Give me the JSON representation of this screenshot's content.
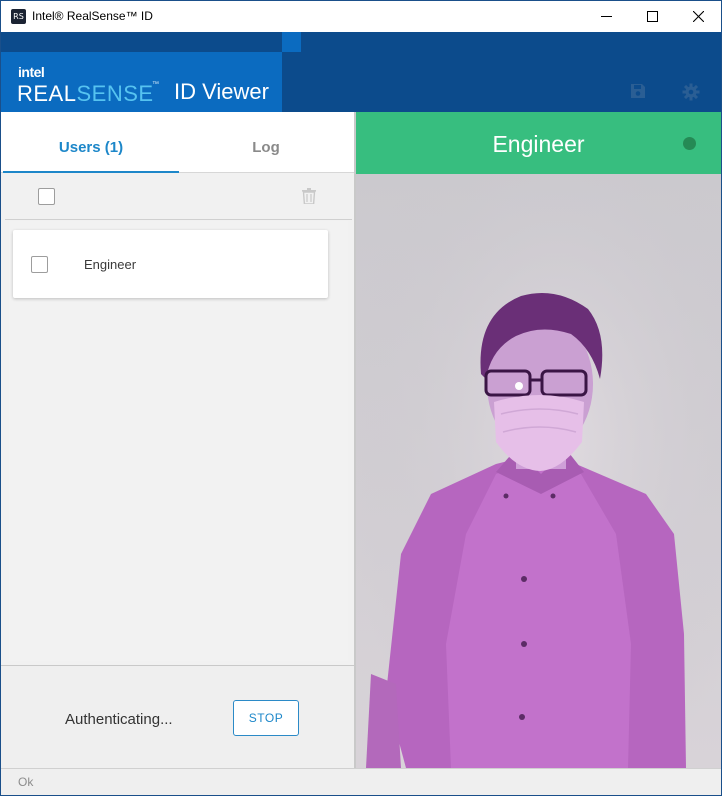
{
  "window": {
    "title": "Intel® RealSense™ ID",
    "app_icon_text": "RS"
  },
  "header": {
    "brand_intel": "intel",
    "brand_real": "REAL",
    "brand_sense": "SENSE",
    "brand_tm": "™",
    "app_title": "ID Viewer",
    "icons": [
      "save-icon",
      "gear-icon"
    ]
  },
  "tabs": {
    "users_label": "Users (1)",
    "log_label": "Log",
    "active": "Users (1)"
  },
  "users": {
    "items": [
      {
        "name": "Engineer",
        "checked": false
      }
    ]
  },
  "actions": {
    "status_text": "Authenticating...",
    "stop_label": "STOP"
  },
  "preview": {
    "title": "Engineer",
    "status_color": "#258a55",
    "header_color": "#37be7f"
  },
  "statusbar": {
    "text": "Ok"
  },
  "colors": {
    "accent": "#1d87c9",
    "header_bg": "#0c4b8c",
    "brand_bg": "#0b6bc0"
  }
}
